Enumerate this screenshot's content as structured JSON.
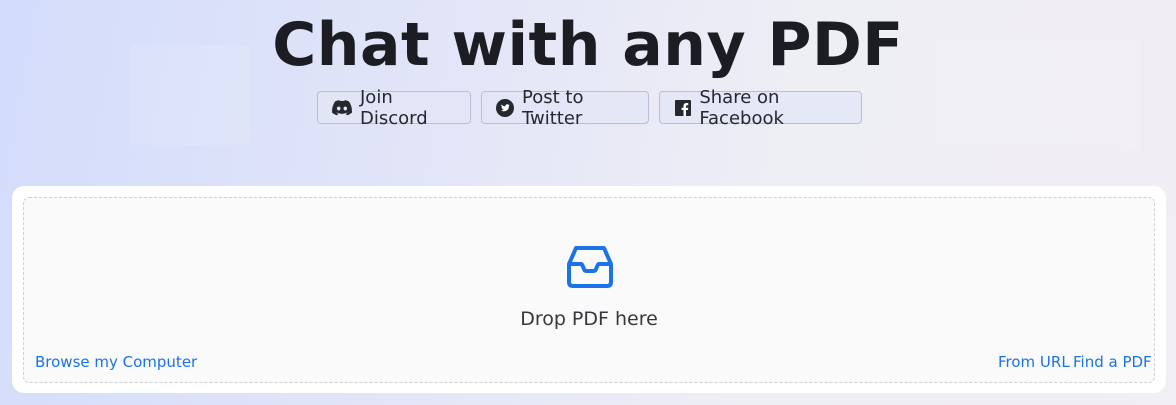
{
  "header": {
    "title": "Chat with any PDF"
  },
  "share_buttons": [
    {
      "label": "Join Discord",
      "icon": "discord-icon"
    },
    {
      "label": "Post to Twitter",
      "icon": "twitter-icon"
    },
    {
      "label": "Share on Facebook",
      "icon": "facebook-icon"
    }
  ],
  "upload": {
    "icon": "inbox-icon",
    "drop_label": "Drop PDF here",
    "browse_label": "Browse my Computer",
    "from_url_label": "From URL",
    "find_pdf_label": "Find a PDF"
  },
  "colors": {
    "accent": "#1a73e8",
    "title_text": "#1b1d22"
  }
}
